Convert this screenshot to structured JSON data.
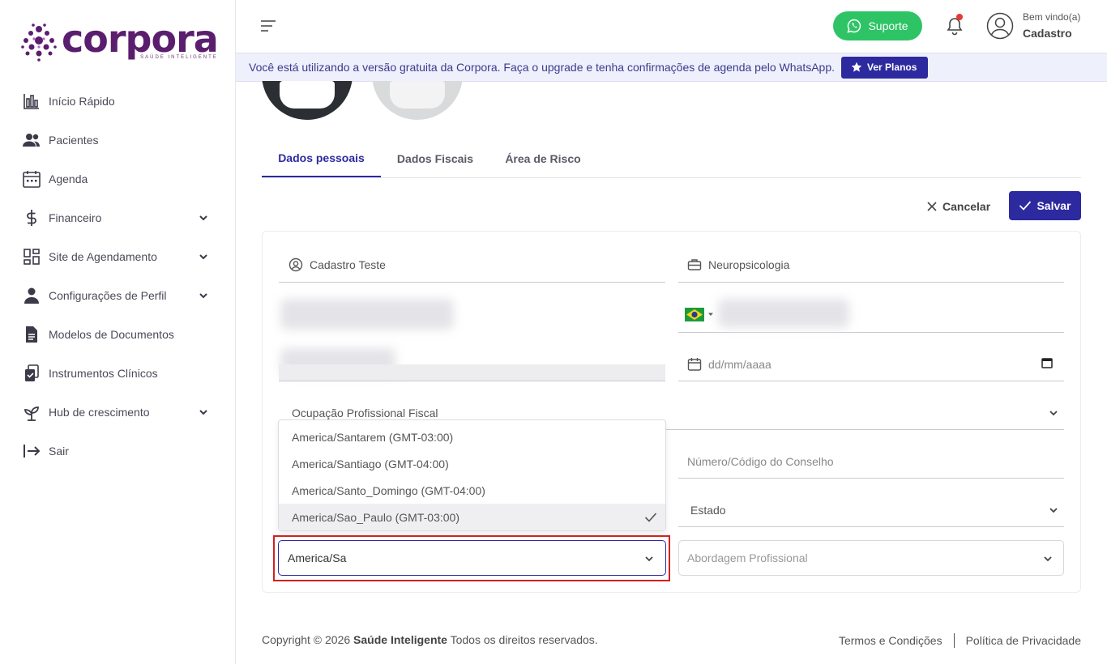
{
  "brand": {
    "name": "corpora",
    "tagline": "SAÚDE INTELIGENTE",
    "primary": "#2d2aa0",
    "logo_color": "#5b1e6e"
  },
  "sidebar": {
    "items": [
      {
        "label": "Início Rápido",
        "icon": "bar-chart-icon",
        "has_submenu": false
      },
      {
        "label": "Pacientes",
        "icon": "users-icon",
        "has_submenu": false
      },
      {
        "label": "Agenda",
        "icon": "calendar-icon",
        "has_submenu": false
      },
      {
        "label": "Financeiro",
        "icon": "dollar-icon",
        "has_submenu": true
      },
      {
        "label": "Site de Agendamento",
        "icon": "grid-icon",
        "has_submenu": true
      },
      {
        "label": "Configurações de Perfil",
        "icon": "person-icon",
        "has_submenu": true
      },
      {
        "label": "Modelos de Documentos",
        "icon": "document-icon",
        "has_submenu": false
      },
      {
        "label": "Instrumentos Clínicos",
        "icon": "clipboard-icon",
        "has_submenu": false
      },
      {
        "label": "Hub de crescimento",
        "icon": "sprout-icon",
        "has_submenu": true
      },
      {
        "label": "Sair",
        "icon": "logout-icon",
        "has_submenu": false
      }
    ]
  },
  "header": {
    "support_label": "Suporte",
    "support_color": "#2ec466",
    "welcome": "Bem vindo(a)",
    "user_name": "Cadastro"
  },
  "banner": {
    "text": "Você está utilizando a versão gratuita da Corpora. Faça o upgrade e tenha confirmações de agenda pelo WhatsApp.",
    "button": "Ver Planos"
  },
  "tabs": [
    {
      "label": "Dados pessoais",
      "active": true
    },
    {
      "label": "Dados Fiscais",
      "active": false
    },
    {
      "label": "Área de Risco",
      "active": false
    }
  ],
  "actions": {
    "cancel": "Cancelar",
    "save": "Salvar"
  },
  "form": {
    "name": "Cadastro Teste",
    "specialty": "Neuropsicologia",
    "birthdate_placeholder": "dd/mm/aaaa",
    "occupation_placeholder": "Ocupação Profissional Fiscal",
    "council_placeholder": "Número/Código do Conselho",
    "state_placeholder": "Estado",
    "timezone_value": "America/Sa",
    "approach_placeholder": "Abordagem Profissional"
  },
  "timezone_options": [
    {
      "label": "America/Santarem (GMT-03:00)",
      "selected": false
    },
    {
      "label": "America/Santiago (GMT-04:00)",
      "selected": false
    },
    {
      "label": "America/Santo_Domingo (GMT-04:00)",
      "selected": false
    },
    {
      "label": "America/Sao_Paulo (GMT-03:00)",
      "selected": true
    }
  ],
  "footer": {
    "copyright_prefix": "Copyright © 2026",
    "company": "Saúde Inteligente",
    "copyright_suffix": "Todos os direitos reservados.",
    "terms": "Termos e Condições",
    "privacy": "Política de Privacidade"
  }
}
